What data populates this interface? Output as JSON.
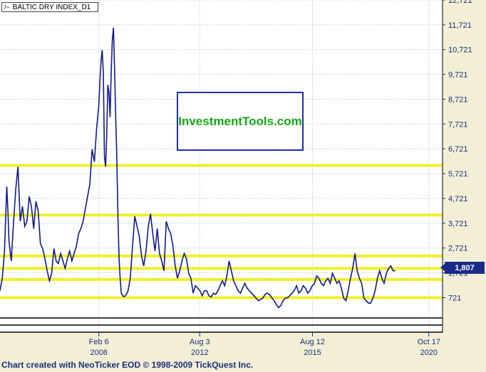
{
  "chart_data": {
    "type": "line",
    "title": "BALTIC DRY INDEX_D1",
    "series": [
      {
        "name": "BALTIC DRY INDEX_D1",
        "values": [
          [
            2003.7,
            1000
          ],
          [
            2003.8,
            1500
          ],
          [
            2003.9,
            2600
          ],
          [
            2004.0,
            5200
          ],
          [
            2004.05,
            4300
          ],
          [
            2004.1,
            3000
          ],
          [
            2004.2,
            2200
          ],
          [
            2004.3,
            3700
          ],
          [
            2004.4,
            5100
          ],
          [
            2004.5,
            6000
          ],
          [
            2004.6,
            3800
          ],
          [
            2004.7,
            4400
          ],
          [
            2004.8,
            3600
          ],
          [
            2004.9,
            3800
          ],
          [
            2005.0,
            4800
          ],
          [
            2005.1,
            4400
          ],
          [
            2005.2,
            3500
          ],
          [
            2005.3,
            4600
          ],
          [
            2005.4,
            4200
          ],
          [
            2005.5,
            2900
          ],
          [
            2005.6,
            2700
          ],
          [
            2005.7,
            2300
          ],
          [
            2005.8,
            1800
          ],
          [
            2005.9,
            1400
          ],
          [
            2006.0,
            1700
          ],
          [
            2006.1,
            2700
          ],
          [
            2006.2,
            2200
          ],
          [
            2006.3,
            2100
          ],
          [
            2006.4,
            2500
          ],
          [
            2006.5,
            2200
          ],
          [
            2006.6,
            1900
          ],
          [
            2006.7,
            2300
          ],
          [
            2006.8,
            2600
          ],
          [
            2006.9,
            2200
          ],
          [
            2007.0,
            2500
          ],
          [
            2007.1,
            2800
          ],
          [
            2007.2,
            3300
          ],
          [
            2007.3,
            3500
          ],
          [
            2007.4,
            3800
          ],
          [
            2007.5,
            4300
          ],
          [
            2007.6,
            4800
          ],
          [
            2007.7,
            5300
          ],
          [
            2007.8,
            6700
          ],
          [
            2007.9,
            6200
          ],
          [
            2008.0,
            7500
          ],
          [
            2008.1,
            8500
          ],
          [
            2008.15,
            9500
          ],
          [
            2008.2,
            10300
          ],
          [
            2008.25,
            10700
          ],
          [
            2008.3,
            9800
          ],
          [
            2008.35,
            6400
          ],
          [
            2008.4,
            6000
          ],
          [
            2008.45,
            7200
          ],
          [
            2008.5,
            9300
          ],
          [
            2008.55,
            9000
          ],
          [
            2008.6,
            8000
          ],
          [
            2008.65,
            9800
          ],
          [
            2008.7,
            11100
          ],
          [
            2008.75,
            11600
          ],
          [
            2008.8,
            9900
          ],
          [
            2008.85,
            8100
          ],
          [
            2008.9,
            6400
          ],
          [
            2008.95,
            4000
          ],
          [
            2009.0,
            2300
          ],
          [
            2009.05,
            1500
          ],
          [
            2009.1,
            900
          ],
          [
            2009.2,
            760
          ],
          [
            2009.3,
            800
          ],
          [
            2009.4,
            1000
          ],
          [
            2009.5,
            1500
          ],
          [
            2009.6,
            2800
          ],
          [
            2009.7,
            4000
          ],
          [
            2009.8,
            3600
          ],
          [
            2009.9,
            3200
          ],
          [
            2010.0,
            2400
          ],
          [
            2010.1,
            2000
          ],
          [
            2010.2,
            2600
          ],
          [
            2010.3,
            3600
          ],
          [
            2010.4,
            4100
          ],
          [
            2010.5,
            3300
          ],
          [
            2010.6,
            2600
          ],
          [
            2010.7,
            3500
          ],
          [
            2010.8,
            2500
          ],
          [
            2010.9,
            2200
          ],
          [
            2011.0,
            1800
          ],
          [
            2011.1,
            3800
          ],
          [
            2011.2,
            3500
          ],
          [
            2011.3,
            3300
          ],
          [
            2011.4,
            2800
          ],
          [
            2011.5,
            2000
          ],
          [
            2011.6,
            1500
          ],
          [
            2011.7,
            1800
          ],
          [
            2011.8,
            2200
          ],
          [
            2011.9,
            2500
          ],
          [
            2012.0,
            2300
          ],
          [
            2012.1,
            1700
          ],
          [
            2012.2,
            1500
          ],
          [
            2012.3,
            900
          ],
          [
            2012.4,
            1200
          ],
          [
            2012.5,
            1100
          ],
          [
            2012.6,
            1000
          ],
          [
            2012.7,
            800
          ],
          [
            2012.8,
            1000
          ],
          [
            2012.9,
            1000
          ],
          [
            2013.0,
            800
          ],
          [
            2013.1,
            750
          ],
          [
            2013.2,
            900
          ],
          [
            2013.3,
            850
          ],
          [
            2013.4,
            1000
          ],
          [
            2013.5,
            1200
          ],
          [
            2013.6,
            1400
          ],
          [
            2013.7,
            1200
          ],
          [
            2013.8,
            1600
          ],
          [
            2013.9,
            2200
          ],
          [
            2014.0,
            1800
          ],
          [
            2014.1,
            1400
          ],
          [
            2014.2,
            1200
          ],
          [
            2014.3,
            1000
          ],
          [
            2014.4,
            900
          ],
          [
            2014.5,
            1100
          ],
          [
            2014.6,
            1300
          ],
          [
            2014.7,
            1100
          ],
          [
            2014.8,
            1000
          ],
          [
            2014.9,
            900
          ],
          [
            2015.0,
            800
          ],
          [
            2015.1,
            700
          ],
          [
            2015.2,
            600
          ],
          [
            2015.3,
            650
          ],
          [
            2015.4,
            700
          ],
          [
            2015.5,
            850
          ],
          [
            2015.6,
            900
          ],
          [
            2015.7,
            850
          ],
          [
            2015.8,
            720
          ],
          [
            2015.9,
            600
          ],
          [
            2016.0,
            450
          ],
          [
            2016.1,
            320
          ],
          [
            2016.2,
            400
          ],
          [
            2016.3,
            600
          ],
          [
            2016.4,
            700
          ],
          [
            2016.5,
            720
          ],
          [
            2016.6,
            800
          ],
          [
            2016.7,
            900
          ],
          [
            2016.8,
            1000
          ],
          [
            2016.9,
            1200
          ],
          [
            2017.0,
            900
          ],
          [
            2017.1,
            1000
          ],
          [
            2017.2,
            1200
          ],
          [
            2017.3,
            1100
          ],
          [
            2017.4,
            900
          ],
          [
            2017.5,
            1000
          ],
          [
            2017.6,
            1200
          ],
          [
            2017.7,
            1300
          ],
          [
            2017.8,
            1600
          ],
          [
            2017.9,
            1500
          ],
          [
            2018.0,
            1300
          ],
          [
            2018.1,
            1200
          ],
          [
            2018.2,
            1400
          ],
          [
            2018.3,
            1500
          ],
          [
            2018.4,
            1300
          ],
          [
            2018.5,
            1700
          ],
          [
            2018.6,
            1500
          ],
          [
            2018.7,
            1300
          ],
          [
            2018.8,
            1400
          ],
          [
            2018.9,
            1100
          ],
          [
            2019.0,
            700
          ],
          [
            2019.1,
            600
          ],
          [
            2019.2,
            1000
          ],
          [
            2019.3,
            1500
          ],
          [
            2019.4,
            1900
          ],
          [
            2019.5,
            2500
          ],
          [
            2019.6,
            1800
          ],
          [
            2019.7,
            1500
          ],
          [
            2019.8,
            1300
          ],
          [
            2019.9,
            700
          ],
          [
            2020.0,
            600
          ],
          [
            2020.1,
            500
          ],
          [
            2020.2,
            500
          ],
          [
            2020.3,
            700
          ],
          [
            2020.4,
            1000
          ],
          [
            2020.5,
            1500
          ],
          [
            2020.6,
            1800
          ],
          [
            2020.7,
            1500
          ],
          [
            2020.8,
            1300
          ],
          [
            2020.9,
            1700
          ],
          [
            2021.0,
            1900
          ],
          [
            2021.1,
            2000
          ],
          [
            2021.2,
            1800
          ],
          [
            2021.3,
            1807
          ]
        ]
      }
    ],
    "horizontal_lines": [
      6050,
      4050,
      2400,
      1900,
      1450,
      720
    ],
    "ylim": [
      -700,
      12721
    ],
    "xlim": [
      2003.7,
      2023.4
    ],
    "y_ticks": [
      721,
      1721,
      2721,
      3721,
      4721,
      5721,
      6721,
      7721,
      8721,
      9721,
      10721,
      11721,
      12721
    ],
    "y_tick_labels": [
      "721",
      "1,721",
      "2,721",
      "3,721",
      "4,721",
      "5,721",
      "6,721",
      "7,721",
      "8,721",
      "9,721",
      "10,721",
      "11,721",
      "12,721"
    ],
    "x_ticks": [
      {
        "pos": 2008.1,
        "line1": "Feb 6",
        "line2": "2008"
      },
      {
        "pos": 2012.59,
        "line1": "Aug 3",
        "line2": "2012"
      },
      {
        "pos": 2017.61,
        "line1": "Aug 12",
        "line2": "2015"
      },
      {
        "pos": 2022.79,
        "line1": "Oct 17",
        "line2": "2020"
      }
    ],
    "last_value_label": "1,807",
    "grid": true,
    "colors": {
      "background": "#ffffff",
      "line": "#101a8a",
      "h_lines": "#f2ee2a",
      "grid": "#b8b8b8",
      "page": "#f2efd6",
      "watermark_text": "#14a814",
      "watermark_border": "#1f2fa8"
    }
  },
  "watermark": {
    "text": "InvestmentTools.com"
  },
  "footer": {
    "text": "Chart created with NeoTicker EOD © 1998-2009 TickQuest Inc."
  }
}
